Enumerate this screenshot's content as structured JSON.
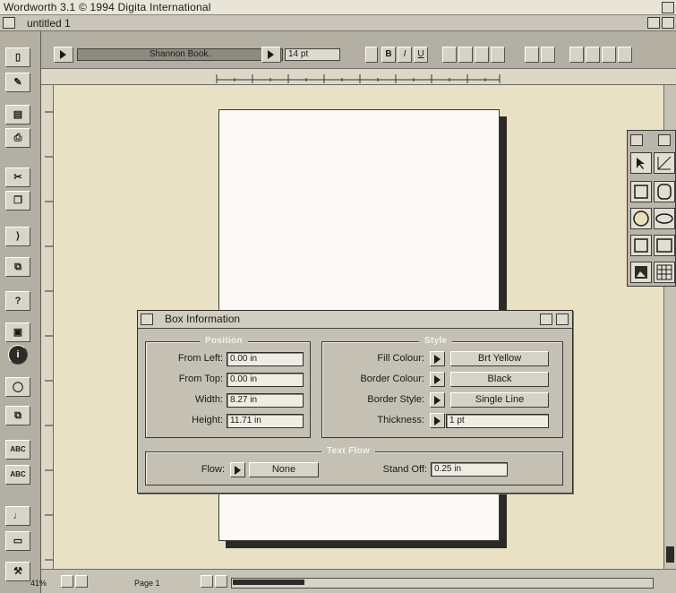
{
  "screen": {
    "title": "Wordworth 3.1 © 1994 Digita International"
  },
  "window": {
    "title": "untitled 1"
  },
  "toolbar": {
    "font_name": "Shannon Book.",
    "font_size": "14 pt"
  },
  "status": {
    "zoom": "41%",
    "page": "Page 1"
  },
  "dialog": {
    "title": "Box Information",
    "position": {
      "group_title": "Position",
      "from_left_label": "From Left:",
      "from_left_value": "0.00 in",
      "from_top_label": "From Top:",
      "from_top_value": "0.00 in",
      "width_label": "Width:",
      "width_value": "8.27 in",
      "height_label": "Height:",
      "height_value": "11.71 in"
    },
    "style": {
      "group_title": "Style",
      "fill_colour_label": "Fill Colour:",
      "fill_colour_value": "Brt Yellow",
      "border_colour_label": "Border Colour:",
      "border_colour_value": "Black",
      "border_style_label": "Border Style:",
      "border_style_value": "Single Line",
      "thickness_label": "Thickness:",
      "thickness_value": "1 pt"
    },
    "text_flow": {
      "group_title": "Text Flow",
      "flow_label": "Flow:",
      "flow_value": "None",
      "stand_off_label": "Stand Off:",
      "stand_off_value": "0.25 in"
    }
  },
  "colors": {
    "desktop": "#e9e1c4",
    "page": "#fbfaf6",
    "chrome": "#b3afa3"
  }
}
